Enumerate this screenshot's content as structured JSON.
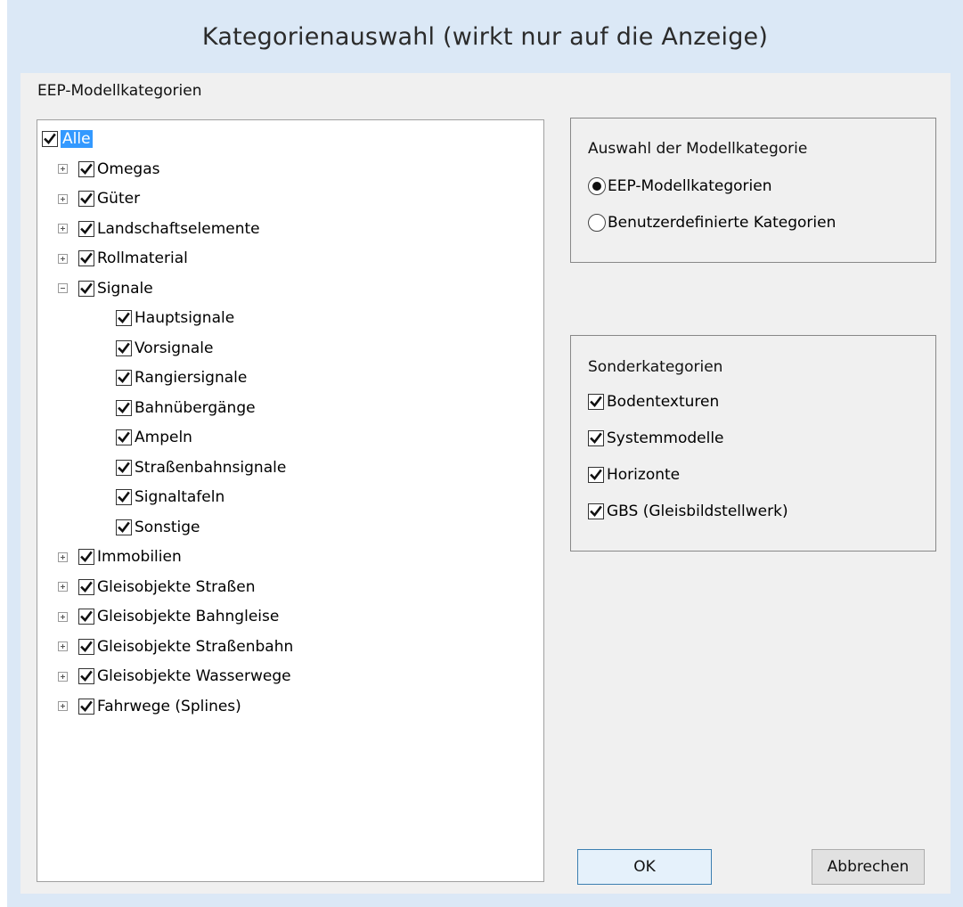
{
  "window": {
    "title": "Kategorienauswahl (wirkt nur auf die Anzeige)"
  },
  "tree_panel": {
    "label": "EEP-Modellkategorien",
    "items": [
      {
        "label": "Alle",
        "checked": true,
        "selected": true,
        "level": 0,
        "expander": "none"
      },
      {
        "label": "Omegas",
        "checked": true,
        "level": 1,
        "expander": "plus"
      },
      {
        "label": "Güter",
        "checked": true,
        "level": 1,
        "expander": "plus"
      },
      {
        "label": "Landschaftselemente",
        "checked": true,
        "level": 1,
        "expander": "plus"
      },
      {
        "label": "Rollmaterial",
        "checked": true,
        "level": 1,
        "expander": "plus"
      },
      {
        "label": "Signale",
        "checked": true,
        "level": 1,
        "expander": "minus"
      },
      {
        "label": "Hauptsignale",
        "checked": true,
        "level": 2,
        "expander": "none"
      },
      {
        "label": "Vorsignale",
        "checked": true,
        "level": 2,
        "expander": "none"
      },
      {
        "label": "Rangiersignale",
        "checked": true,
        "level": 2,
        "expander": "none"
      },
      {
        "label": "Bahnübergänge",
        "checked": true,
        "level": 2,
        "expander": "none"
      },
      {
        "label": "Ampeln",
        "checked": true,
        "level": 2,
        "expander": "none"
      },
      {
        "label": "Straßenbahnsignale",
        "checked": true,
        "level": 2,
        "expander": "none"
      },
      {
        "label": "Signaltafeln",
        "checked": true,
        "level": 2,
        "expander": "none"
      },
      {
        "label": "Sonstige",
        "checked": true,
        "level": 2,
        "expander": "none"
      },
      {
        "label": "Immobilien",
        "checked": true,
        "level": 1,
        "expander": "plus"
      },
      {
        "label": "Gleisobjekte Straßen",
        "checked": true,
        "level": 1,
        "expander": "plus"
      },
      {
        "label": "Gleisobjekte Bahngleise",
        "checked": true,
        "level": 1,
        "expander": "plus"
      },
      {
        "label": "Gleisobjekte Straßenbahn",
        "checked": true,
        "level": 1,
        "expander": "plus"
      },
      {
        "label": "Gleisobjekte Wasserwege",
        "checked": true,
        "level": 1,
        "expander": "plus"
      },
      {
        "label": "Fahrwege (Splines)",
        "checked": true,
        "level": 1,
        "expander": "plus"
      }
    ]
  },
  "category_mode": {
    "title": "Auswahl der Modellkategorie",
    "options": [
      {
        "label": "EEP-Modellkategorien",
        "selected": true
      },
      {
        "label": "Benutzerdefinierte Kategorien",
        "selected": false
      }
    ]
  },
  "special_categories": {
    "title": "Sonderkategorien",
    "items": [
      {
        "label": "Bodentexturen",
        "checked": true
      },
      {
        "label": "Systemmodelle",
        "checked": true
      },
      {
        "label": "Horizonte",
        "checked": true
      },
      {
        "label": "GBS (Gleisbildstellwerk)",
        "checked": true
      }
    ]
  },
  "buttons": {
    "ok": "OK",
    "cancel": "Abbrechen"
  }
}
